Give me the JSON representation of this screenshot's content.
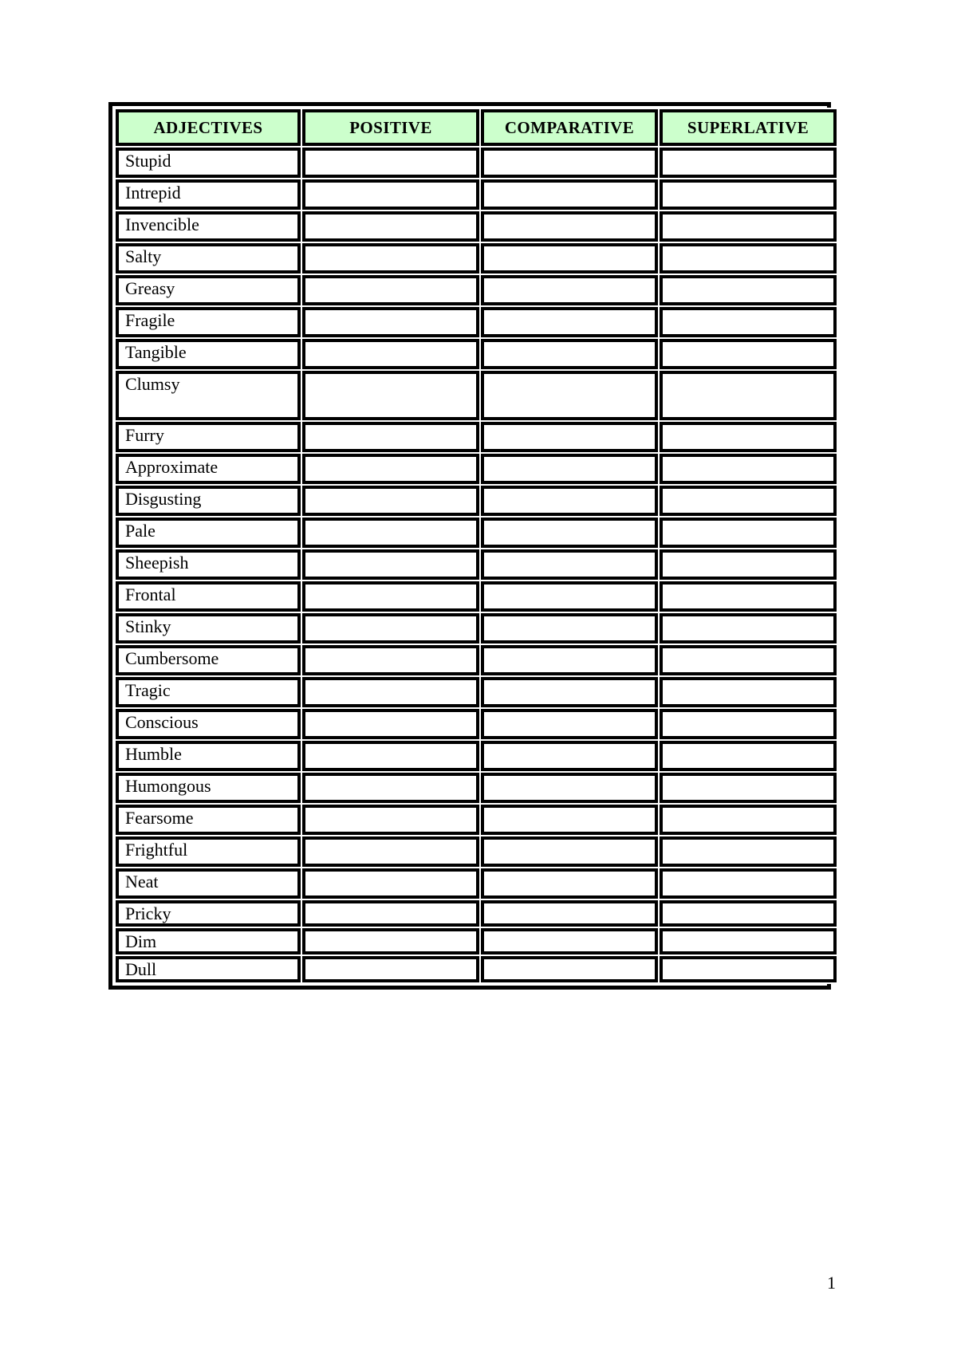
{
  "document": {
    "page_number": "1",
    "header_bg_color": "#CCFFCC",
    "border_color": "#000000",
    "page_bg_color": "#FFFFFF"
  },
  "table": {
    "columns": [
      {
        "key": "adjectives",
        "label": "ADJECTIVES"
      },
      {
        "key": "positive",
        "label": "POSITIVE"
      },
      {
        "key": "comparative",
        "label": "COMPARATIVE"
      },
      {
        "key": "superlative",
        "label": "SUPERLATIVE"
      }
    ],
    "rows": [
      {
        "adjective": "Stupid",
        "positive": "",
        "comparative": "",
        "superlative": ""
      },
      {
        "adjective": "Intrepid",
        "positive": "",
        "comparative": "",
        "superlative": ""
      },
      {
        "adjective": "Invencible",
        "positive": "",
        "comparative": "",
        "superlative": ""
      },
      {
        "adjective": "Salty",
        "positive": "",
        "comparative": "",
        "superlative": ""
      },
      {
        "adjective": "Greasy",
        "positive": "",
        "comparative": "",
        "superlative": ""
      },
      {
        "adjective": "Fragile",
        "positive": "",
        "comparative": "",
        "superlative": ""
      },
      {
        "adjective": "Tangible",
        "positive": "",
        "comparative": "",
        "superlative": ""
      },
      {
        "adjective": "Clumsy",
        "positive": "",
        "comparative": "",
        "superlative": ""
      },
      {
        "adjective": "Furry",
        "positive": "",
        "comparative": "",
        "superlative": ""
      },
      {
        "adjective": "Approximate",
        "positive": "",
        "comparative": "",
        "superlative": ""
      },
      {
        "adjective": "Disgusting",
        "positive": "",
        "comparative": "",
        "superlative": ""
      },
      {
        "adjective": "Pale",
        "positive": "",
        "comparative": "",
        "superlative": ""
      },
      {
        "adjective": "Sheepish",
        "positive": "",
        "comparative": "",
        "superlative": ""
      },
      {
        "adjective": "Frontal",
        "positive": "",
        "comparative": "",
        "superlative": ""
      },
      {
        "adjective": "Stinky",
        "positive": "",
        "comparative": "",
        "superlative": ""
      },
      {
        "adjective": "Cumbersome",
        "positive": "",
        "comparative": "",
        "superlative": ""
      },
      {
        "adjective": "Tragic",
        "positive": "",
        "comparative": "",
        "superlative": ""
      },
      {
        "adjective": "Conscious",
        "positive": "",
        "comparative": "",
        "superlative": ""
      },
      {
        "adjective": "Humble",
        "positive": "",
        "comparative": "",
        "superlative": ""
      },
      {
        "adjective": "Humongous",
        "positive": "",
        "comparative": "",
        "superlative": ""
      },
      {
        "adjective": "Fearsome",
        "positive": "",
        "comparative": "",
        "superlative": ""
      },
      {
        "adjective": "Frightful",
        "positive": "",
        "comparative": "",
        "superlative": ""
      },
      {
        "adjective": "Neat",
        "positive": "",
        "comparative": "",
        "superlative": ""
      },
      {
        "adjective": "Pricky",
        "positive": "",
        "comparative": "",
        "superlative": ""
      },
      {
        "adjective": "Dim",
        "positive": "",
        "comparative": "",
        "superlative": ""
      },
      {
        "adjective": "Dull",
        "positive": "",
        "comparative": "",
        "superlative": ""
      }
    ]
  }
}
